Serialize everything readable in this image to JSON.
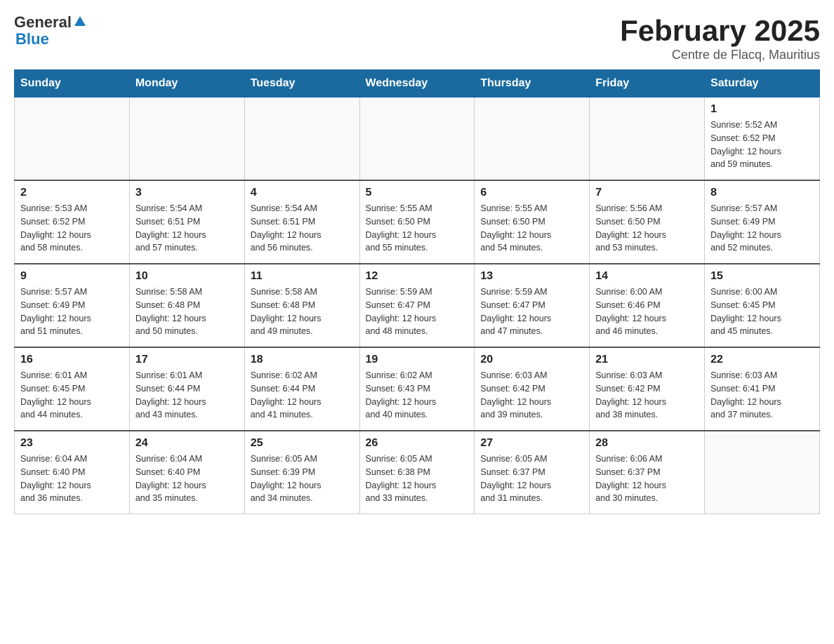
{
  "header": {
    "logo": {
      "general": "General",
      "blue": "Blue"
    },
    "title": "February 2025",
    "location": "Centre de Flacq, Mauritius"
  },
  "calendar": {
    "days_of_week": [
      "Sunday",
      "Monday",
      "Tuesday",
      "Wednesday",
      "Thursday",
      "Friday",
      "Saturday"
    ],
    "weeks": [
      {
        "days": [
          {
            "number": "",
            "info": ""
          },
          {
            "number": "",
            "info": ""
          },
          {
            "number": "",
            "info": ""
          },
          {
            "number": "",
            "info": ""
          },
          {
            "number": "",
            "info": ""
          },
          {
            "number": "",
            "info": ""
          },
          {
            "number": "1",
            "info": "Sunrise: 5:52 AM\nSunset: 6:52 PM\nDaylight: 12 hours\nand 59 minutes."
          }
        ]
      },
      {
        "days": [
          {
            "number": "2",
            "info": "Sunrise: 5:53 AM\nSunset: 6:52 PM\nDaylight: 12 hours\nand 58 minutes."
          },
          {
            "number": "3",
            "info": "Sunrise: 5:54 AM\nSunset: 6:51 PM\nDaylight: 12 hours\nand 57 minutes."
          },
          {
            "number": "4",
            "info": "Sunrise: 5:54 AM\nSunset: 6:51 PM\nDaylight: 12 hours\nand 56 minutes."
          },
          {
            "number": "5",
            "info": "Sunrise: 5:55 AM\nSunset: 6:50 PM\nDaylight: 12 hours\nand 55 minutes."
          },
          {
            "number": "6",
            "info": "Sunrise: 5:55 AM\nSunset: 6:50 PM\nDaylight: 12 hours\nand 54 minutes."
          },
          {
            "number": "7",
            "info": "Sunrise: 5:56 AM\nSunset: 6:50 PM\nDaylight: 12 hours\nand 53 minutes."
          },
          {
            "number": "8",
            "info": "Sunrise: 5:57 AM\nSunset: 6:49 PM\nDaylight: 12 hours\nand 52 minutes."
          }
        ]
      },
      {
        "days": [
          {
            "number": "9",
            "info": "Sunrise: 5:57 AM\nSunset: 6:49 PM\nDaylight: 12 hours\nand 51 minutes."
          },
          {
            "number": "10",
            "info": "Sunrise: 5:58 AM\nSunset: 6:48 PM\nDaylight: 12 hours\nand 50 minutes."
          },
          {
            "number": "11",
            "info": "Sunrise: 5:58 AM\nSunset: 6:48 PM\nDaylight: 12 hours\nand 49 minutes."
          },
          {
            "number": "12",
            "info": "Sunrise: 5:59 AM\nSunset: 6:47 PM\nDaylight: 12 hours\nand 48 minutes."
          },
          {
            "number": "13",
            "info": "Sunrise: 5:59 AM\nSunset: 6:47 PM\nDaylight: 12 hours\nand 47 minutes."
          },
          {
            "number": "14",
            "info": "Sunrise: 6:00 AM\nSunset: 6:46 PM\nDaylight: 12 hours\nand 46 minutes."
          },
          {
            "number": "15",
            "info": "Sunrise: 6:00 AM\nSunset: 6:45 PM\nDaylight: 12 hours\nand 45 minutes."
          }
        ]
      },
      {
        "days": [
          {
            "number": "16",
            "info": "Sunrise: 6:01 AM\nSunset: 6:45 PM\nDaylight: 12 hours\nand 44 minutes."
          },
          {
            "number": "17",
            "info": "Sunrise: 6:01 AM\nSunset: 6:44 PM\nDaylight: 12 hours\nand 43 minutes."
          },
          {
            "number": "18",
            "info": "Sunrise: 6:02 AM\nSunset: 6:44 PM\nDaylight: 12 hours\nand 41 minutes."
          },
          {
            "number": "19",
            "info": "Sunrise: 6:02 AM\nSunset: 6:43 PM\nDaylight: 12 hours\nand 40 minutes."
          },
          {
            "number": "20",
            "info": "Sunrise: 6:03 AM\nSunset: 6:42 PM\nDaylight: 12 hours\nand 39 minutes."
          },
          {
            "number": "21",
            "info": "Sunrise: 6:03 AM\nSunset: 6:42 PM\nDaylight: 12 hours\nand 38 minutes."
          },
          {
            "number": "22",
            "info": "Sunrise: 6:03 AM\nSunset: 6:41 PM\nDaylight: 12 hours\nand 37 minutes."
          }
        ]
      },
      {
        "days": [
          {
            "number": "23",
            "info": "Sunrise: 6:04 AM\nSunset: 6:40 PM\nDaylight: 12 hours\nand 36 minutes."
          },
          {
            "number": "24",
            "info": "Sunrise: 6:04 AM\nSunset: 6:40 PM\nDaylight: 12 hours\nand 35 minutes."
          },
          {
            "number": "25",
            "info": "Sunrise: 6:05 AM\nSunset: 6:39 PM\nDaylight: 12 hours\nand 34 minutes."
          },
          {
            "number": "26",
            "info": "Sunrise: 6:05 AM\nSunset: 6:38 PM\nDaylight: 12 hours\nand 33 minutes."
          },
          {
            "number": "27",
            "info": "Sunrise: 6:05 AM\nSunset: 6:37 PM\nDaylight: 12 hours\nand 31 minutes."
          },
          {
            "number": "28",
            "info": "Sunrise: 6:06 AM\nSunset: 6:37 PM\nDaylight: 12 hours\nand 30 minutes."
          },
          {
            "number": "",
            "info": ""
          }
        ]
      }
    ]
  }
}
